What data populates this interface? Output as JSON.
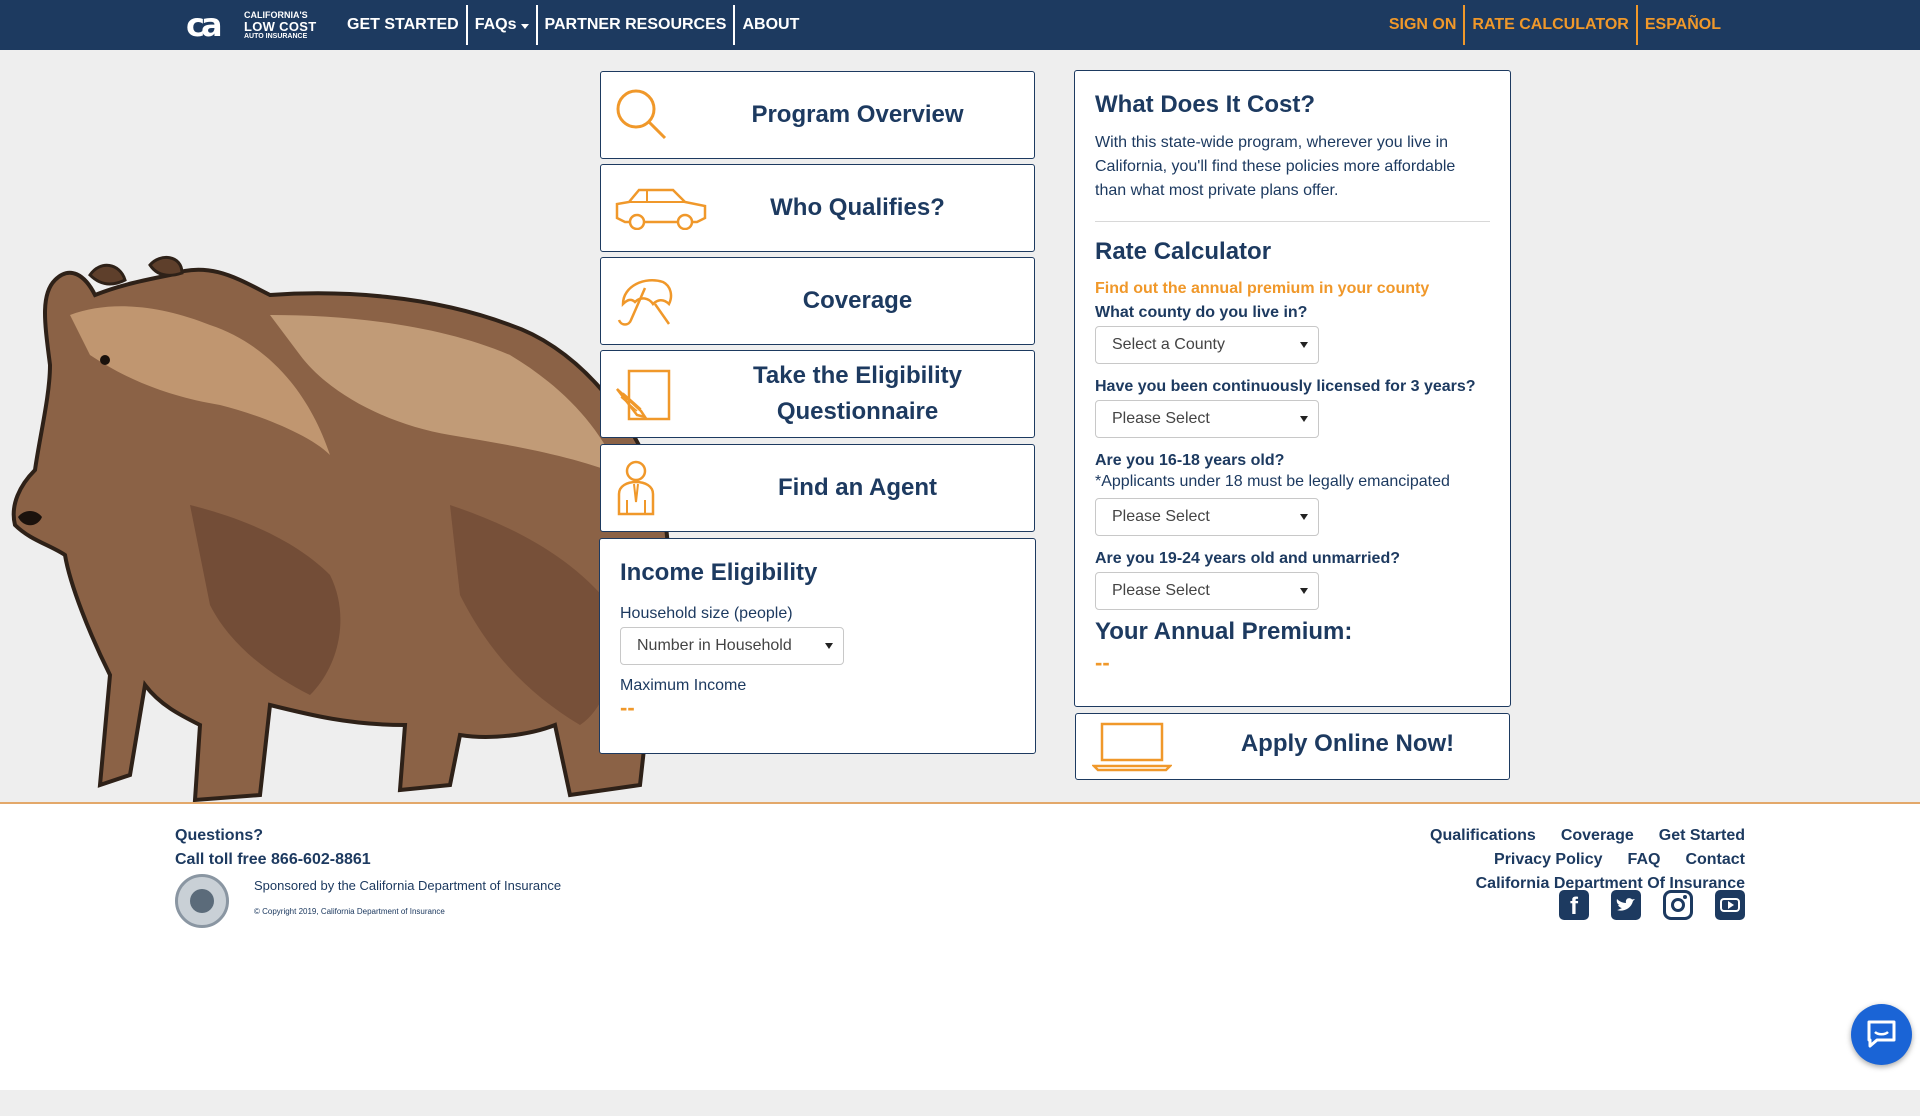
{
  "nav": {
    "logo_line1": "CALIFORNIA'S",
    "logo_line2": "LOW COST",
    "logo_line3": "AUTO INSURANCE",
    "left_links": [
      "GET STARTED",
      "FAQs",
      "PARTNER RESOURCES",
      "ABOUT"
    ],
    "right_links": [
      "SIGN ON",
      "RATE CALCULATOR",
      "ESPAÑOL"
    ]
  },
  "cards": [
    {
      "title": "Program Overview",
      "icon": "magnifier-icon"
    },
    {
      "title": "Who Qualifies?",
      "icon": "car-icon"
    },
    {
      "title": "Coverage",
      "icon": "umbrella-icon"
    },
    {
      "title_line1": "Take the Eligibility",
      "title_line2": "Questionnaire",
      "icon": "pencil-paper-icon"
    },
    {
      "title": "Find an Agent",
      "icon": "agent-icon"
    }
  ],
  "income": {
    "title": "Income Eligibility",
    "household_label": "Household size (people)",
    "household_select": "Number in Household",
    "max_income_label": "Maximum Income",
    "max_income_value": "--"
  },
  "cost": {
    "title": "What Does It Cost?",
    "description": "With this state-wide program, wherever you live in California, you'll find these policies more affordable than what most private plans offer.",
    "rate_title": "Rate Calculator",
    "rate_subtitle": "Find out the annual premium in your county",
    "county_question": "What county do you live in?",
    "county_select": "Select a County",
    "licensed_question": "Have you been continuously licensed for 3 years?",
    "licensed_select": "Please Select",
    "age_question": "Are you 16-18 years old?",
    "age_note": "*Applicants under 18 must be legally emancipated",
    "age_select": "Please Select",
    "unmarried_question": "Are you 19-24 years old and unmarried?",
    "unmarried_select": "Please Select",
    "premium_title": "Your Annual Premium:",
    "premium_value": "--"
  },
  "apply": {
    "title": "Apply Online Now!",
    "icon": "laptop-icon"
  },
  "footer": {
    "questions": "Questions?",
    "phone": "Call toll free 866-602-8861",
    "sponsored": "Sponsored by the California Department of Insurance",
    "copyright": "© Copyright 2019, California Department of Insurance",
    "links_row1": [
      "Qualifications",
      "Coverage",
      "Get Started"
    ],
    "links_row2": [
      "Privacy Policy",
      "FAQ",
      "Contact"
    ],
    "links_row3": "California Department Of Insurance",
    "socials": [
      "facebook-icon",
      "twitter-icon",
      "instagram-icon",
      "youtube-icon"
    ]
  },
  "colors": {
    "navy": "#1d3a60",
    "orange": "#f0982a",
    "background": "#eeeeee",
    "chat": "#1a64d6"
  }
}
